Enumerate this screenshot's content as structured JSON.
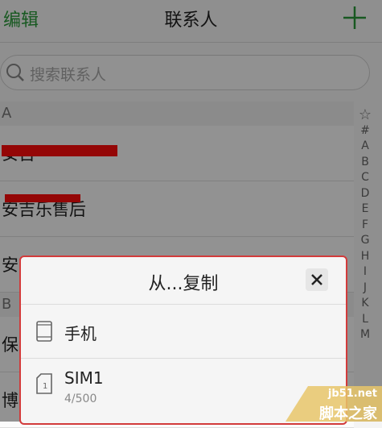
{
  "header": {
    "edit_label": "编辑",
    "title": "联系人",
    "add_icon": "plus-icon",
    "accent": "#2a9a3a"
  },
  "search": {
    "placeholder": "搜索联系人",
    "icon": "search-icon"
  },
  "sections": [
    {
      "letter": "A",
      "rows": [
        "安吉",
        "安吉乐售后",
        "安吉钧业之家"
      ]
    },
    {
      "letter": "B",
      "rows": [
        "保",
        "博"
      ]
    }
  ],
  "index_bar": [
    "☆",
    "#",
    "A",
    "B",
    "C",
    "D",
    "E",
    "F",
    "G",
    "H",
    "I",
    "J",
    "K",
    "L",
    "M"
  ],
  "dialog": {
    "title": "从...复制",
    "close_icon": "close-icon",
    "options": [
      {
        "label": "手机",
        "icon": "phone-icon"
      },
      {
        "label": "SIM1",
        "sub": "4/500",
        "icon": "sim-card-icon"
      }
    ],
    "border_color": "#d23b3b"
  },
  "watermark": {
    "url": "jb51.net",
    "brand": "脚本之家"
  }
}
